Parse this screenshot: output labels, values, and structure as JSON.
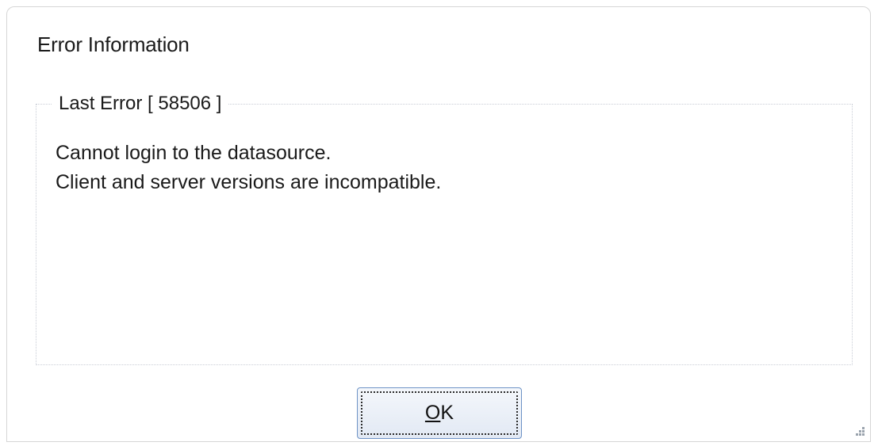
{
  "dialog": {
    "title": "Error Information",
    "group_label": "Last Error [ 58506 ]",
    "message_lines": [
      "Cannot login to the datasource.",
      "Client and server versions are incompatible."
    ],
    "ok_button": {
      "mnemonic": "O",
      "rest": "K"
    }
  },
  "icons": {
    "resize_grip": "resize-grip-icon"
  },
  "colors": {
    "button_border": "#6e93c6",
    "group_border": "#c9cdd6",
    "text": "#1a1a1a"
  }
}
